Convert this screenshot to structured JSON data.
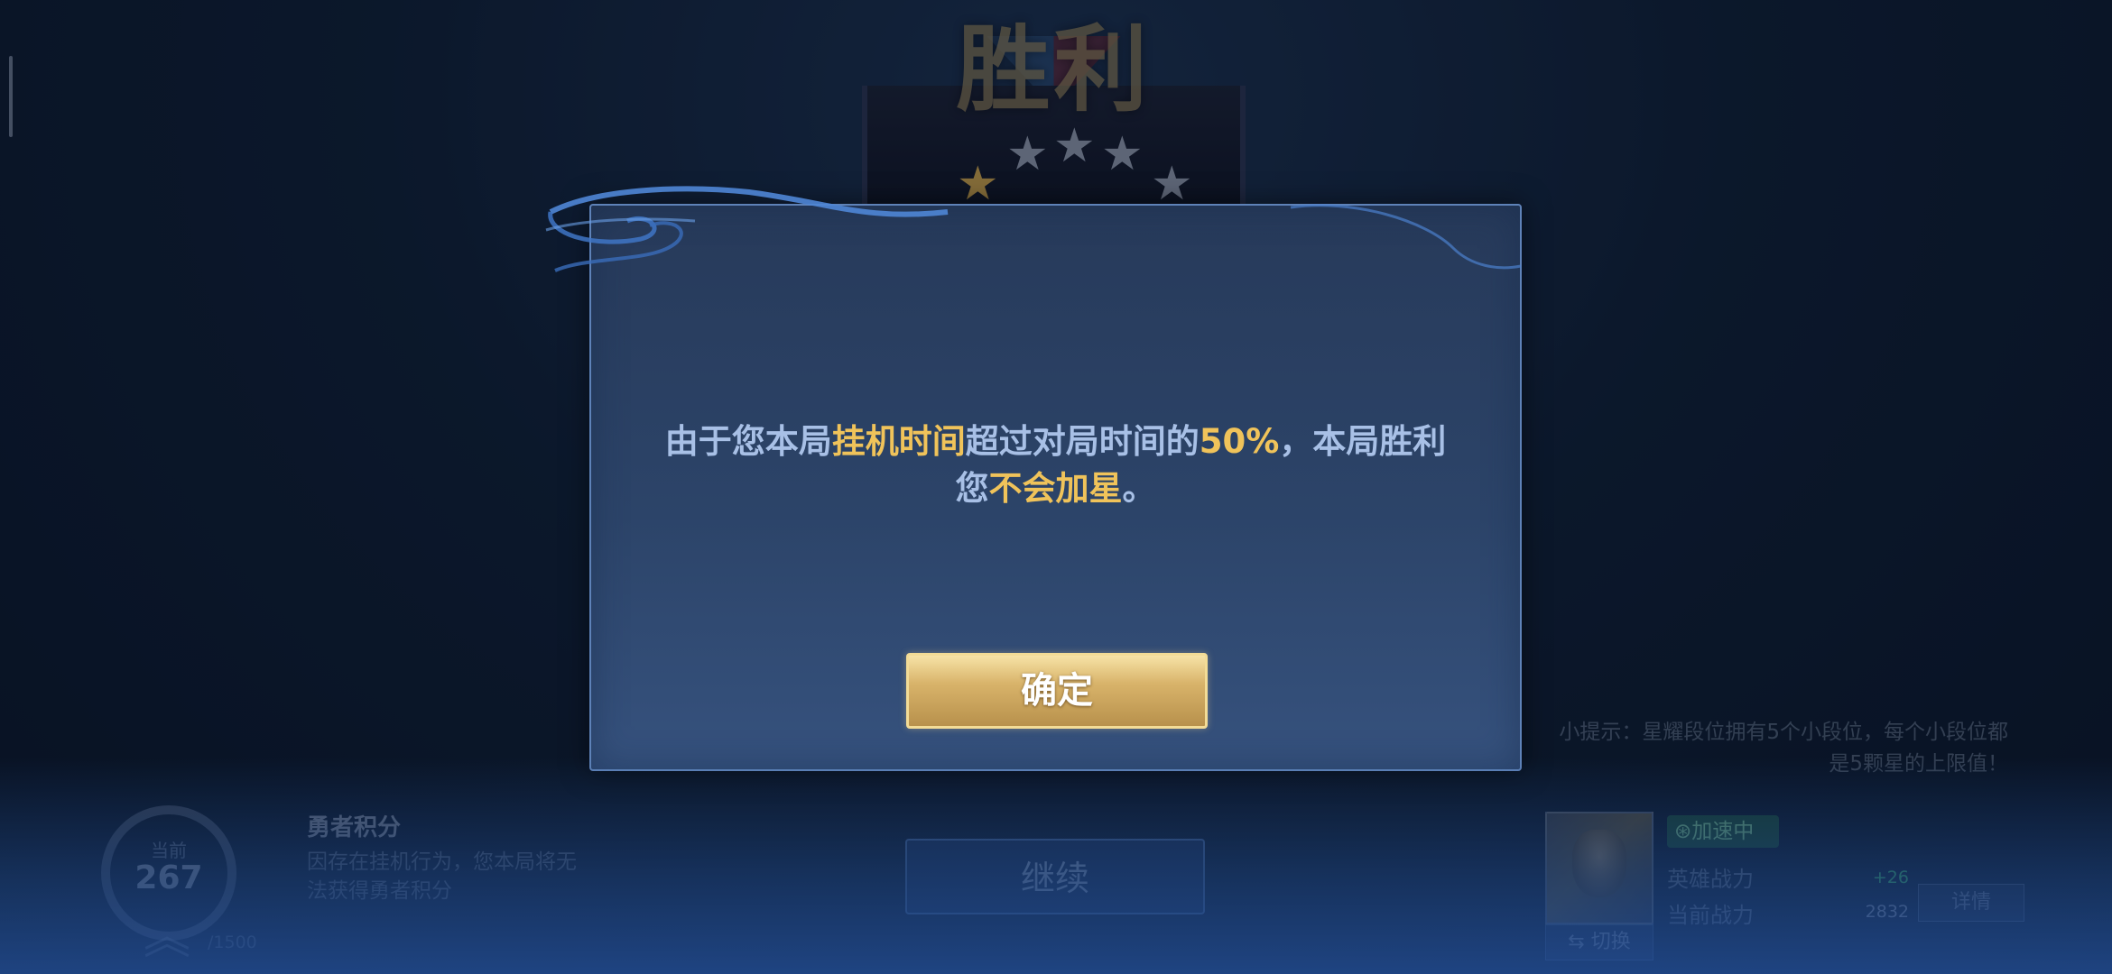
{
  "banner": {
    "title": "胜利",
    "stars": [
      "★",
      "★",
      "★",
      "★",
      "★"
    ],
    "colors": {
      "gold_star": "#c8a04a",
      "silver_star": "#8c96a8"
    }
  },
  "dialog": {
    "message_parts": [
      "由于您本局",
      "挂机时间",
      "超过对局时间的",
      "50%",
      "，本局胜利",
      "您",
      "不会加星",
      "。"
    ],
    "confirm_label": "确定",
    "colors": {
      "text": "#a8c0e6",
      "highlight": "#f0c35a",
      "button_gold": "#d8b36a"
    }
  },
  "score": {
    "label": "当前",
    "value": "267",
    "cap": "/1500",
    "emblem_icon": "chevron-up-icon",
    "title": "勇者积分",
    "description": "因存在挂机行为，您本局将无法获得勇者积分"
  },
  "continue_label": "继续",
  "tip": "小提示：星耀段位拥有5个小段位，每个小段位都是5颗星的上限值！",
  "hero": {
    "portrait_icon": "hero-portrait",
    "switch_icon": "swap-arrows-icon",
    "switch_label": "切换",
    "boost_icon": "boost-icon",
    "boost_label": "加速中",
    "stats": [
      {
        "label": "英雄战力",
        "value": "+26",
        "color": "#3fbf6a"
      },
      {
        "label": "当前战力",
        "value": "2832",
        "color": "#8c96a8"
      }
    ],
    "detail_label": "详情"
  }
}
